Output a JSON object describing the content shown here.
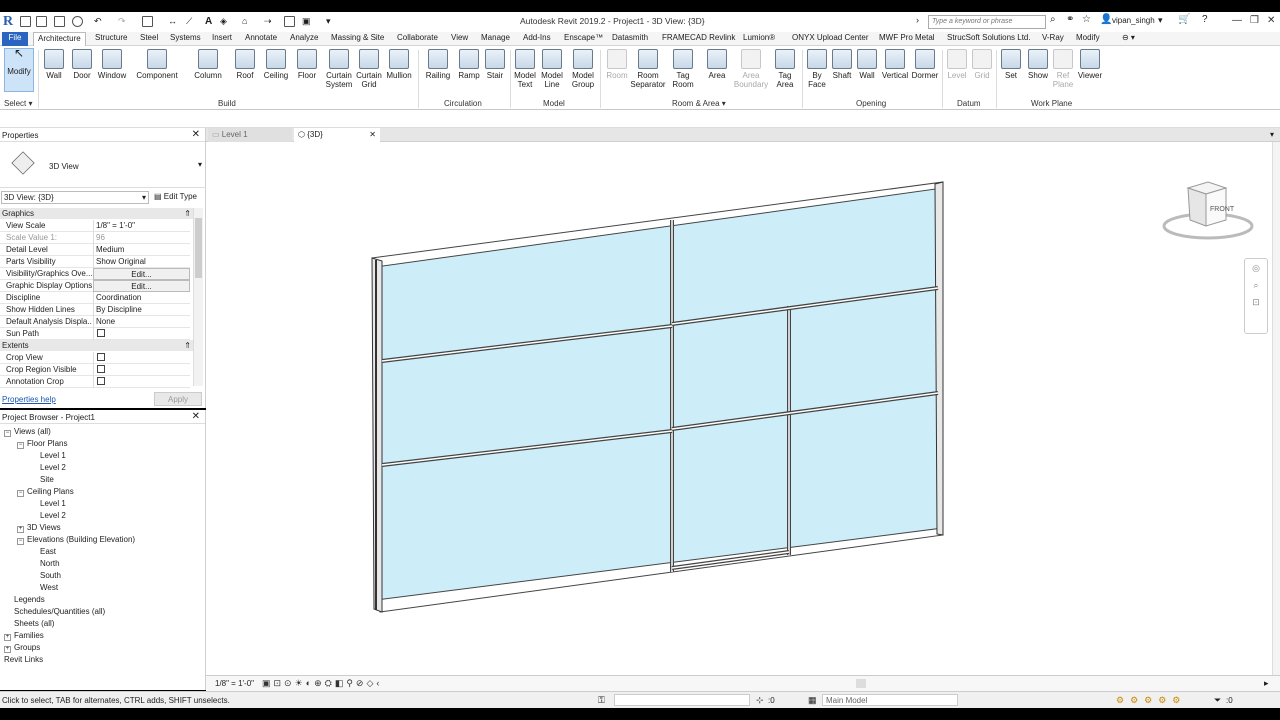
{
  "window": {
    "title": "Autodesk Revit 2019.2 - Project1 - 3D View: {3D}",
    "search_placeholder": "Type a keyword or phrase",
    "user": "vipan_singh"
  },
  "tabs": [
    "File",
    "Architecture",
    "Structure",
    "Steel",
    "Systems",
    "Insert",
    "Annotate",
    "Analyze",
    "Massing & Site",
    "Collaborate",
    "View",
    "Manage",
    "Add-Ins",
    "Enscape™",
    "Datasmith",
    "FRAMECAD Revlink",
    "Lumion®",
    "ONYX Upload Center",
    "MWF Pro Metal",
    "StrucSoft Solutions Ltd.",
    "V-Ray",
    "Modify"
  ],
  "ribbon": {
    "select": {
      "modify": "Modify",
      "label": "Select"
    },
    "build": {
      "label": "Build",
      "items": [
        "Wall",
        "Door",
        "Window",
        "Component",
        "Column",
        "Roof",
        "Ceiling",
        "Floor",
        "Curtain System",
        "Curtain Grid",
        "Mullion"
      ]
    },
    "circulation": {
      "label": "Circulation",
      "items": [
        "Railing",
        "Ramp",
        "Stair"
      ]
    },
    "model": {
      "label": "Model",
      "items": [
        "Model Text",
        "Model Line",
        "Model Group"
      ]
    },
    "room_area": {
      "label": "Room & Area",
      "items": [
        "Room",
        "Room Separator",
        "Tag Room",
        "Area",
        "Area Boundary",
        "Tag Area"
      ]
    },
    "opening": {
      "label": "Opening",
      "items": [
        "By Face",
        "Shaft",
        "Wall",
        "Vertical",
        "Dormer"
      ]
    },
    "datum": {
      "label": "Datum",
      "items": [
        "Level",
        "Grid"
      ]
    },
    "work_plane": {
      "label": "Work Plane",
      "items": [
        "Set",
        "Show",
        "Ref Plane",
        "Viewer"
      ]
    }
  },
  "properties": {
    "title": "Properties",
    "type_name": "3D View",
    "view_selector": "3D View: {3D}",
    "edit_type": "Edit Type",
    "cat_graphics": "Graphics",
    "cat_extents": "Extents",
    "rows": [
      {
        "k": "View Scale",
        "v": "1/8\" = 1'-0\""
      },
      {
        "k": "Scale Value    1:",
        "v": "96"
      },
      {
        "k": "Detail Level",
        "v": "Medium"
      },
      {
        "k": "Parts Visibility",
        "v": "Show Original"
      },
      {
        "k": "Visibility/Graphics Ove...",
        "v": "Edit..."
      },
      {
        "k": "Graphic Display Options",
        "v": "Edit..."
      },
      {
        "k": "Discipline",
        "v": "Coordination"
      },
      {
        "k": "Show Hidden Lines",
        "v": "By Discipline"
      },
      {
        "k": "Default Analysis Displa...",
        "v": "None"
      },
      {
        "k": "Sun Path",
        "v": ""
      }
    ],
    "extent_rows": [
      {
        "k": "Crop View"
      },
      {
        "k": "Crop Region Visible"
      },
      {
        "k": "Annotation Crop"
      }
    ],
    "help": "Properties help",
    "apply": "Apply"
  },
  "browser": {
    "title": "Project Browser - Project1",
    "nodes": [
      {
        "t": "Views (all)",
        "lvl": 0
      },
      {
        "t": "Floor Plans",
        "lvl": 1
      },
      {
        "t": "Level 1",
        "lvl": 2
      },
      {
        "t": "Level 2",
        "lvl": 2
      },
      {
        "t": "Site",
        "lvl": 2
      },
      {
        "t": "Ceiling Plans",
        "lvl": 1
      },
      {
        "t": "Level 1",
        "lvl": 2
      },
      {
        "t": "Level 2",
        "lvl": 2
      },
      {
        "t": "3D Views",
        "lvl": 1
      },
      {
        "t": "Elevations (Building Elevation)",
        "lvl": 1
      },
      {
        "t": "East",
        "lvl": 2
      },
      {
        "t": "North",
        "lvl": 2
      },
      {
        "t": "South",
        "lvl": 2
      },
      {
        "t": "West",
        "lvl": 2
      },
      {
        "t": "Legends",
        "lvl": 0
      },
      {
        "t": "Schedules/Quantities (all)",
        "lvl": 0
      },
      {
        "t": "Sheets (all)",
        "lvl": 0
      },
      {
        "t": "Families",
        "lvl": 0
      },
      {
        "t": "Groups",
        "lvl": 0
      },
      {
        "t": "Revit Links",
        "lvl": 0
      }
    ]
  },
  "doc_tabs": [
    "Level 1",
    "{3D}"
  ],
  "viewcube_label": "FRONT",
  "view_scale": "1/8\" = 1'-0\"",
  "status": {
    "text": "Click to select, TAB for alternates, CTRL adds, SHIFT unselects.",
    "sel_count": ":0",
    "model": "Main Model",
    "filter_count": ":0"
  }
}
